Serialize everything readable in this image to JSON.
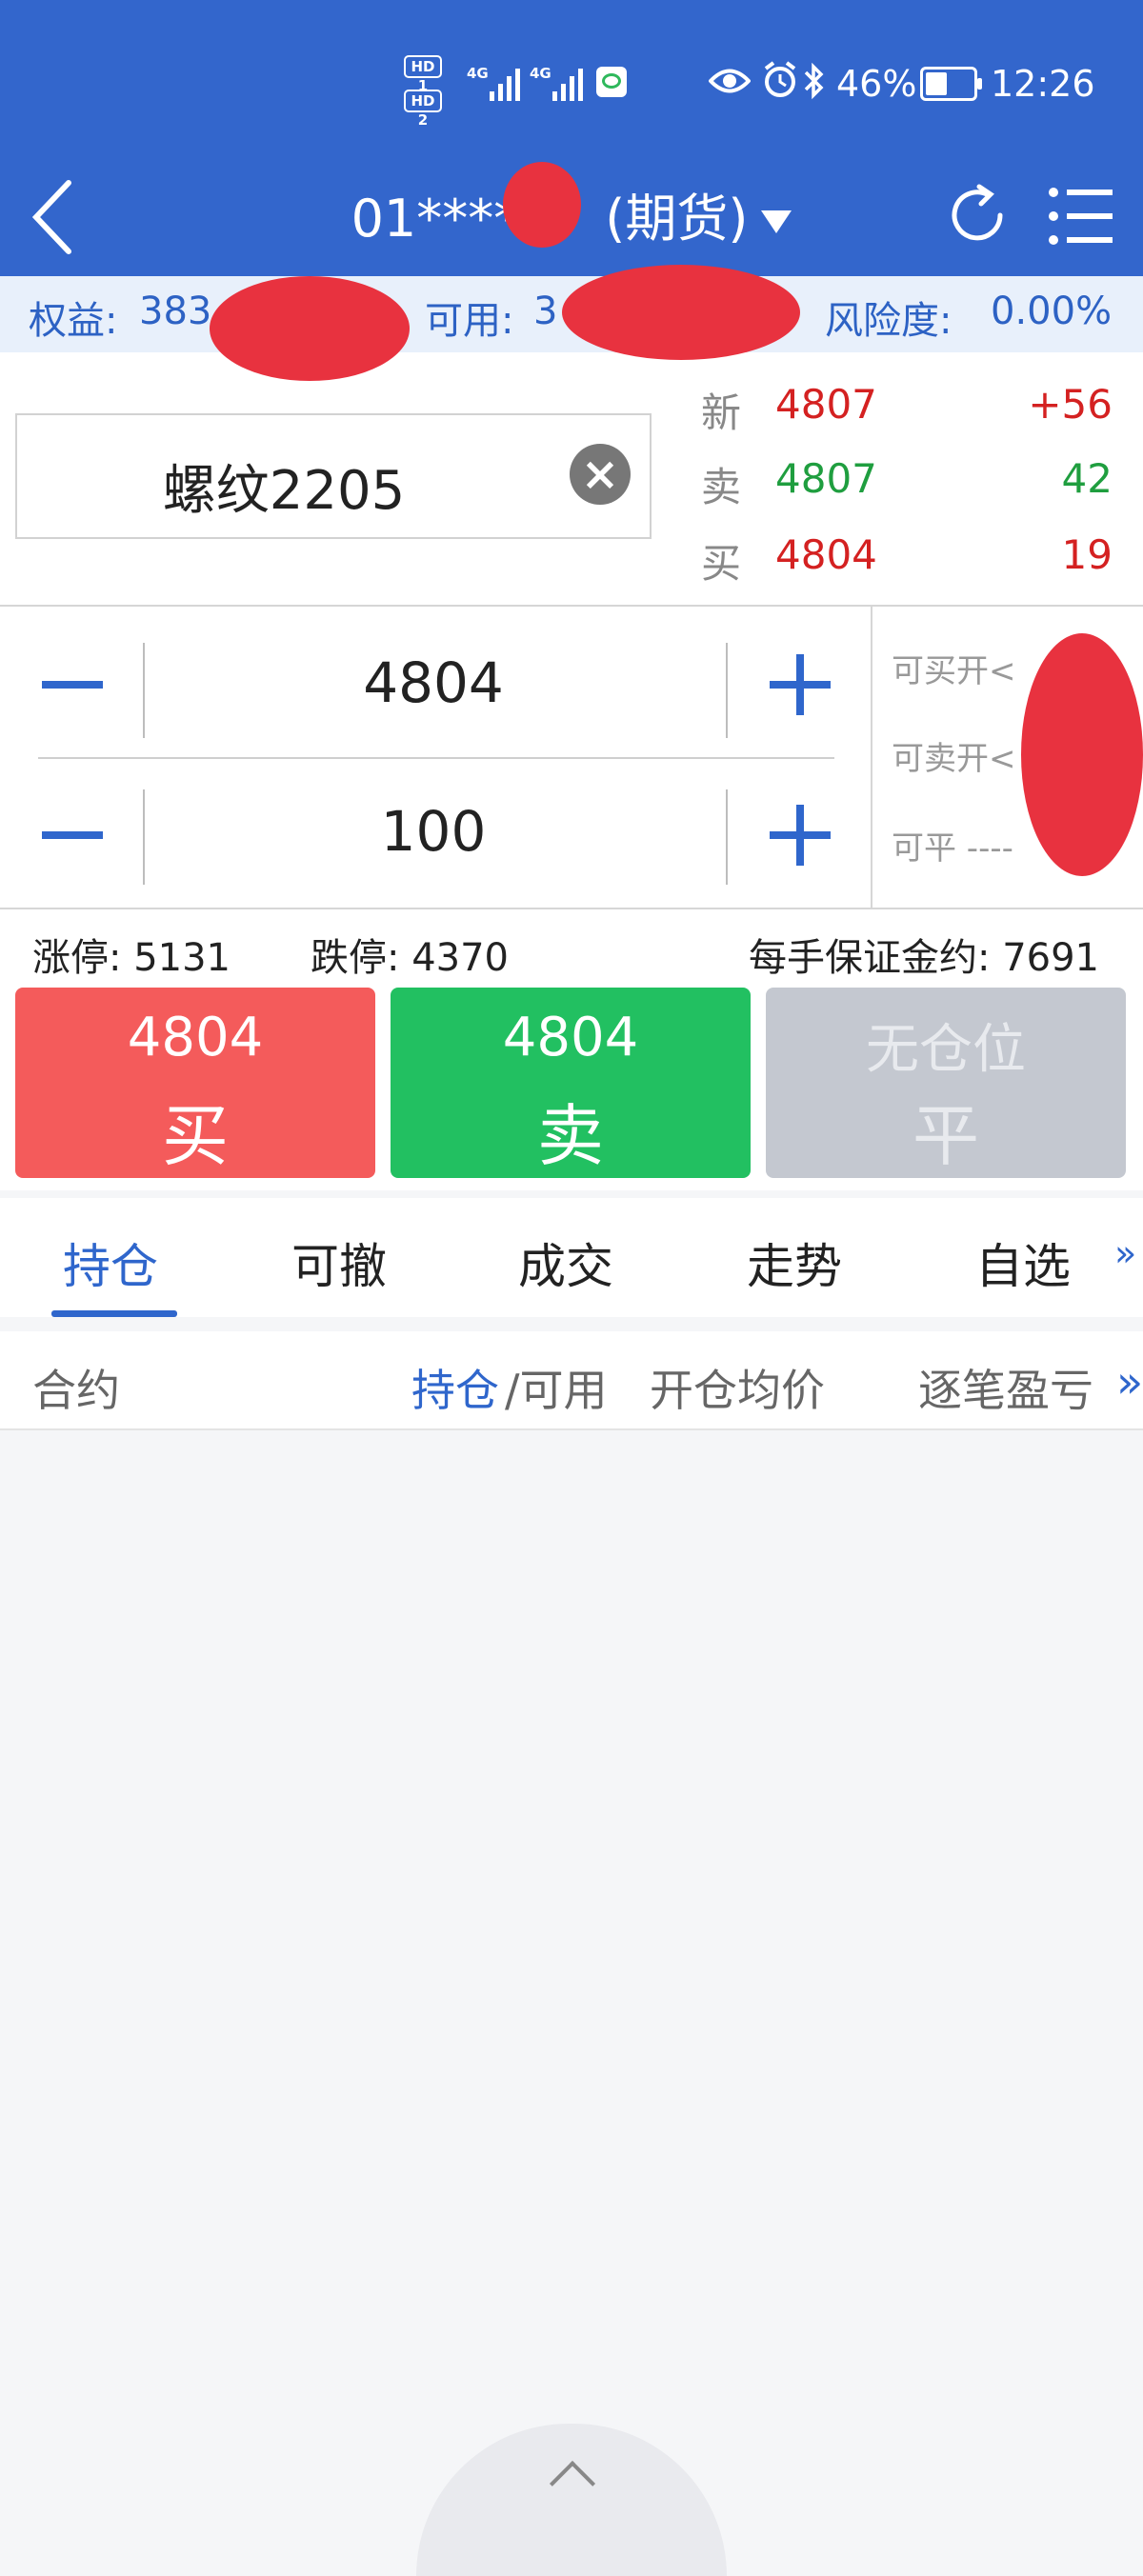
{
  "status_bar": {
    "sim1": "HD 1",
    "sim2": "HD 2",
    "net1": "4G",
    "net2": "4G",
    "battery": "46%",
    "time": "12:26"
  },
  "title_bar": {
    "account_title": "01****",
    "account_type": "(期货)",
    "icons": [
      "back-icon",
      "refresh-icon",
      "menu-icon"
    ]
  },
  "account": {
    "equity_label": "权益:",
    "equity_value": "383",
    "available_label": "可用:",
    "available_value": "3",
    "risk_label": "风险度:",
    "risk_value": "0.00%"
  },
  "quote": {
    "symbol": "螺纹2205",
    "last_label": "新",
    "last_price": "4807",
    "last_change": "+56",
    "ask_label": "卖",
    "ask_price": "4807",
    "ask_volume": "42",
    "bid_label": "买",
    "bid_price": "4804",
    "bid_volume": "19"
  },
  "order": {
    "price": "4804",
    "quantity": "100",
    "can_buy_open": "可买开<",
    "can_sell_open": "可卖开<",
    "can_close": "可平 ----"
  },
  "limits": {
    "upper": "涨停: 5131",
    "lower": "跌停: 4370",
    "margin": "每手保证金约: 7691"
  },
  "actions": {
    "buy_price": "4804",
    "buy_label": "买",
    "sell_price": "4804",
    "sell_label": "卖",
    "close_label_top": "无仓位",
    "close_label": "平"
  },
  "tabs": [
    "持仓",
    "可撤",
    "成交",
    "走势",
    "自选"
  ],
  "tabs_more": "»",
  "table_header": {
    "contract": "合约",
    "position": "持仓",
    "slash_available": "/可用",
    "avg_price": "开仓均价",
    "pnl": "逐笔盈亏",
    "more": "»"
  },
  "colors": {
    "brand_blue": "#3366cc",
    "buy_red": "#f45b5b",
    "sell_green": "#22c061",
    "disabled_gray": "#c4c8d0"
  }
}
